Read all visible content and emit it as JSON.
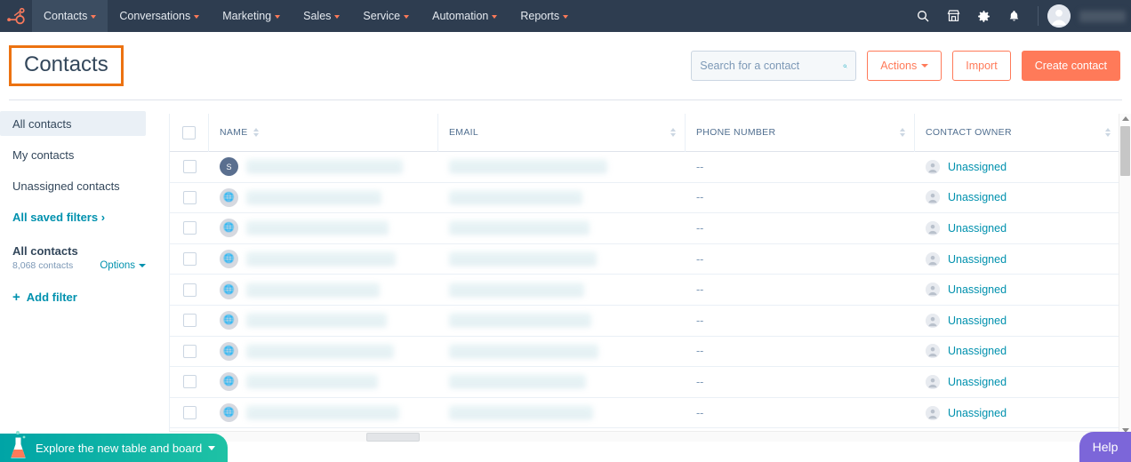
{
  "topnav": {
    "logo": "hubspot-sprocket-logo",
    "items": [
      {
        "label": "Contacts",
        "active": true
      },
      {
        "label": "Conversations",
        "active": false
      },
      {
        "label": "Marketing",
        "active": false
      },
      {
        "label": "Sales",
        "active": false
      },
      {
        "label": "Service",
        "active": false
      },
      {
        "label": "Automation",
        "active": false
      },
      {
        "label": "Reports",
        "active": false
      }
    ],
    "icons": [
      "search-icon",
      "marketplace-icon",
      "settings-gear-icon",
      "notifications-bell-icon"
    ],
    "account_name_redacted": true
  },
  "header": {
    "title": "Contacts",
    "highlight_color": "#ec7211",
    "search": {
      "placeholder": "Search for a contact",
      "value": ""
    },
    "actions_label": "Actions",
    "import_label": "Import",
    "create_label": "Create contact"
  },
  "sidebar": {
    "items": [
      {
        "label": "All contacts",
        "selected": true
      },
      {
        "label": "My contacts",
        "selected": false
      },
      {
        "label": "Unassigned contacts",
        "selected": false
      }
    ],
    "saved_filters_label": "All saved filters ›",
    "current_filter": {
      "title": "All contacts",
      "count": "8,068 contacts",
      "options_label": "Options"
    },
    "add_filter_label": "Add filter"
  },
  "table": {
    "columns": [
      "NAME",
      "EMAIL",
      "PHONE NUMBER",
      "CONTACT OWNER"
    ],
    "rows": [
      {
        "avatar": "S",
        "avatar_type": "initial",
        "name": "",
        "email": "",
        "phone": "--",
        "owner": "Unassigned"
      },
      {
        "avatar": "",
        "avatar_type": "logo",
        "name": "",
        "email": "",
        "phone": "--",
        "owner": "Unassigned"
      },
      {
        "avatar": "",
        "avatar_type": "logo",
        "name": "",
        "email": "",
        "phone": "--",
        "owner": "Unassigned"
      },
      {
        "avatar": "",
        "avatar_type": "logo",
        "name": "",
        "email": "",
        "phone": "--",
        "owner": "Unassigned"
      },
      {
        "avatar": "",
        "avatar_type": "logo",
        "name": "",
        "email": "",
        "phone": "--",
        "owner": "Unassigned"
      },
      {
        "avatar": "",
        "avatar_type": "logo",
        "name": "",
        "email": "",
        "phone": "--",
        "owner": "Unassigned"
      },
      {
        "avatar": "",
        "avatar_type": "logo",
        "name": "",
        "email": "",
        "phone": "--",
        "owner": "Unassigned"
      },
      {
        "avatar": "",
        "avatar_type": "logo",
        "name": "",
        "email": "",
        "phone": "--",
        "owner": "Unassigned"
      },
      {
        "avatar": "",
        "avatar_type": "logo",
        "name": "",
        "email": "",
        "phone": "--",
        "owner": "Unassigned"
      }
    ],
    "redacted_note": "name and email values are blurred in the screenshot"
  },
  "footer": {
    "explore_label": "Explore the new table and board",
    "help_label": "Help"
  },
  "colors": {
    "nav_bg": "#2e3d50",
    "brand_orange": "#ff7a59",
    "highlight_orange": "#ec7211",
    "teal_link": "#0091ae",
    "banner_teal": "#1ec2a5",
    "help_purple": "#7c66d9",
    "text": "#33475b"
  }
}
